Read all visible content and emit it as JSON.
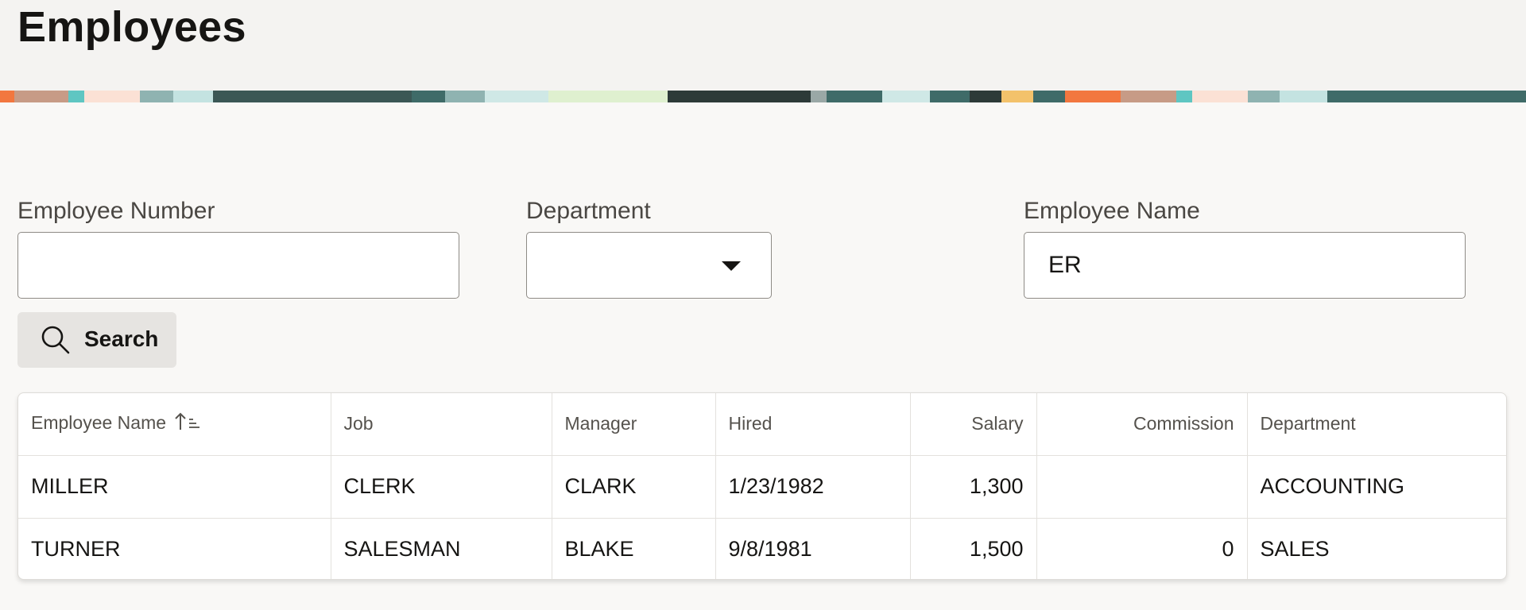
{
  "page": {
    "title": "Employees"
  },
  "filters": {
    "employee_number": {
      "label": "Employee Number",
      "value": ""
    },
    "department": {
      "label": "Department",
      "value": ""
    },
    "employee_name": {
      "label": "Employee Name",
      "value": "ER"
    }
  },
  "search_button": {
    "label": "Search"
  },
  "table": {
    "columns": [
      {
        "label": "Employee Name",
        "align": "left",
        "sorted": "asc"
      },
      {
        "label": "Job",
        "align": "left"
      },
      {
        "label": "Manager",
        "align": "left"
      },
      {
        "label": "Hired",
        "align": "left"
      },
      {
        "label": "Salary",
        "align": "right"
      },
      {
        "label": "Commission",
        "align": "right"
      },
      {
        "label": "Department",
        "align": "left"
      }
    ],
    "rows": [
      [
        "MILLER",
        "CLERK",
        "CLARK",
        "1/23/1982",
        "1,300",
        "",
        "ACCOUNTING"
      ],
      [
        "TURNER",
        "SALESMAN",
        "BLAKE",
        "9/8/1981",
        "1,500",
        "0",
        "SALES"
      ]
    ]
  },
  "colors": {
    "accent_orange": "#f2773f",
    "banner_teal": "#3f6b68",
    "background": "#f9f8f6"
  }
}
